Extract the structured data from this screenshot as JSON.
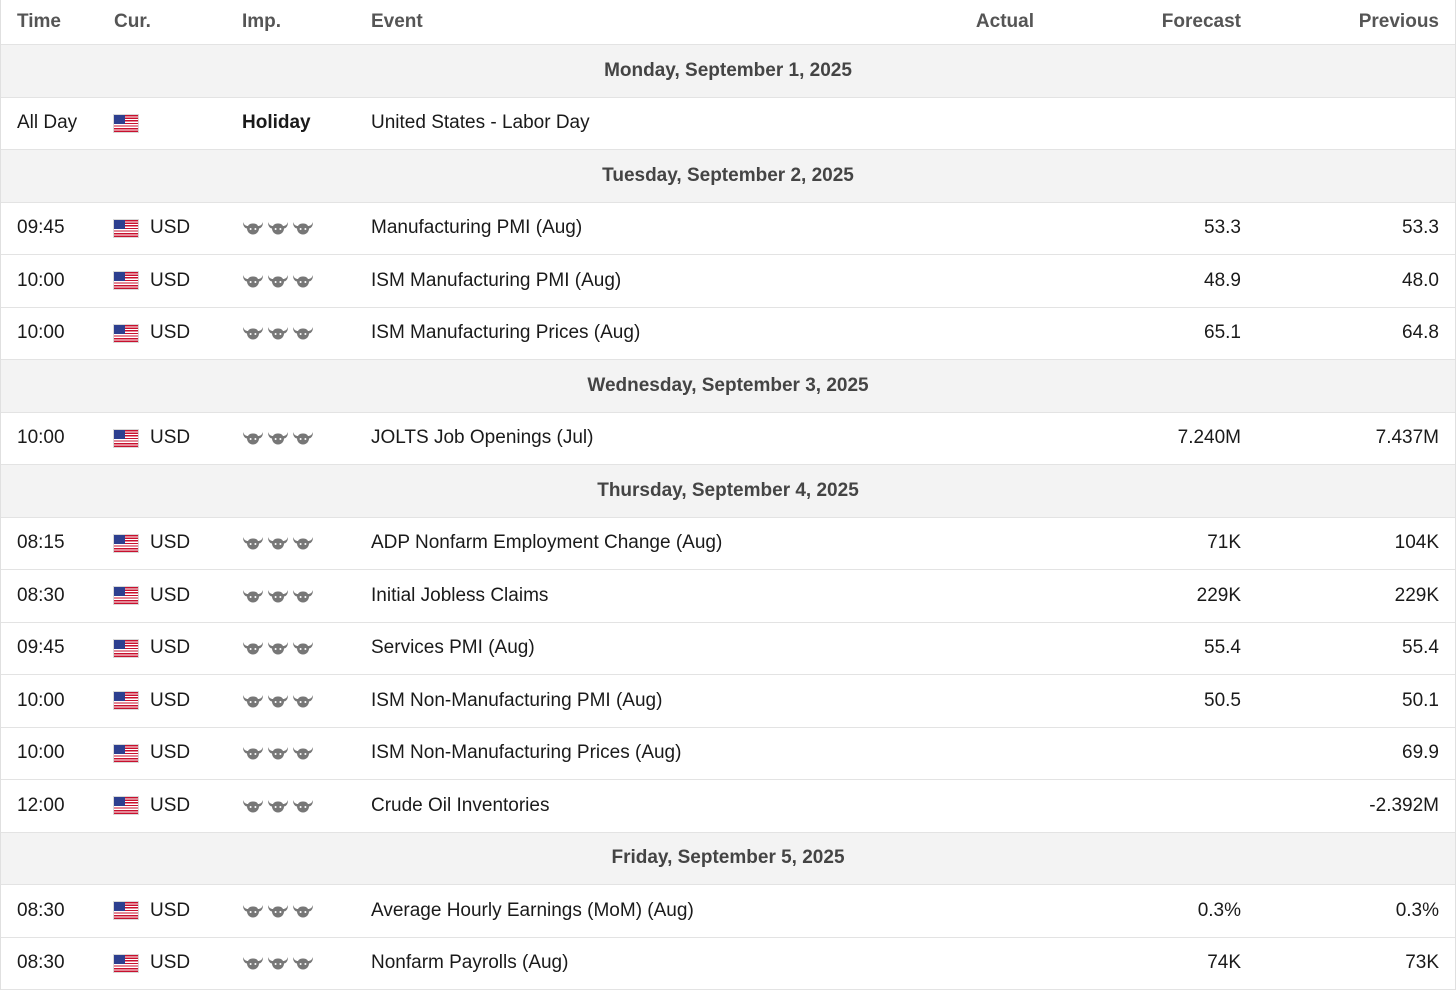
{
  "headers": {
    "time": "Time",
    "currency": "Cur.",
    "importance": "Imp.",
    "event": "Event",
    "actual": "Actual",
    "forecast": "Forecast",
    "previous": "Previous"
  },
  "icons": {
    "flag": "us-flag-icon",
    "importance": "bull-icon"
  },
  "colors": {
    "day_row_bg": "#f3f3f3",
    "bull": "#777777",
    "border": "#e3e3e3"
  },
  "days": [
    {
      "label": "Monday, September 1, 2025",
      "events": [
        {
          "time": "All Day",
          "currency": "",
          "importance_text": "Holiday",
          "event": "United States - Labor Day",
          "actual": "",
          "forecast": "",
          "previous": ""
        }
      ]
    },
    {
      "label": "Tuesday, September 2, 2025",
      "events": [
        {
          "time": "09:45",
          "currency": "USD",
          "importance": 3,
          "event": "Manufacturing PMI (Aug)",
          "actual": "",
          "forecast": "53.3",
          "previous": "53.3"
        },
        {
          "time": "10:00",
          "currency": "USD",
          "importance": 3,
          "event": "ISM Manufacturing PMI (Aug)",
          "actual": "",
          "forecast": "48.9",
          "previous": "48.0"
        },
        {
          "time": "10:00",
          "currency": "USD",
          "importance": 3,
          "event": "ISM Manufacturing Prices (Aug)",
          "actual": "",
          "forecast": "65.1",
          "previous": "64.8"
        }
      ]
    },
    {
      "label": "Wednesday, September 3, 2025",
      "events": [
        {
          "time": "10:00",
          "currency": "USD",
          "importance": 3,
          "event": "JOLTS Job Openings (Jul)",
          "actual": "",
          "forecast": "7.240M",
          "previous": "7.437M"
        }
      ]
    },
    {
      "label": "Thursday, September 4, 2025",
      "events": [
        {
          "time": "08:15",
          "currency": "USD",
          "importance": 3,
          "event": "ADP Nonfarm Employment Change (Aug)",
          "actual": "",
          "forecast": "71K",
          "previous": "104K"
        },
        {
          "time": "08:30",
          "currency": "USD",
          "importance": 3,
          "event": "Initial Jobless Claims",
          "actual": "",
          "forecast": "229K",
          "previous": "229K"
        },
        {
          "time": "09:45",
          "currency": "USD",
          "importance": 3,
          "event": "Services PMI (Aug)",
          "actual": "",
          "forecast": "55.4",
          "previous": "55.4"
        },
        {
          "time": "10:00",
          "currency": "USD",
          "importance": 3,
          "event": "ISM Non-Manufacturing PMI (Aug)",
          "actual": "",
          "forecast": "50.5",
          "previous": "50.1"
        },
        {
          "time": "10:00",
          "currency": "USD",
          "importance": 3,
          "event": "ISM Non-Manufacturing Prices (Aug)",
          "actual": "",
          "forecast": "",
          "previous": "69.9"
        },
        {
          "time": "12:00",
          "currency": "USD",
          "importance": 3,
          "event": "Crude Oil Inventories",
          "actual": "",
          "forecast": "",
          "previous": "-2.392M"
        }
      ]
    },
    {
      "label": "Friday, September 5, 2025",
      "events": [
        {
          "time": "08:30",
          "currency": "USD",
          "importance": 3,
          "event": "Average Hourly Earnings (MoM) (Aug)",
          "actual": "",
          "forecast": "0.3%",
          "previous": "0.3%"
        },
        {
          "time": "08:30",
          "currency": "USD",
          "importance": 3,
          "event": "Nonfarm Payrolls (Aug)",
          "actual": "",
          "forecast": "74K",
          "previous": "73K"
        }
      ]
    }
  ]
}
